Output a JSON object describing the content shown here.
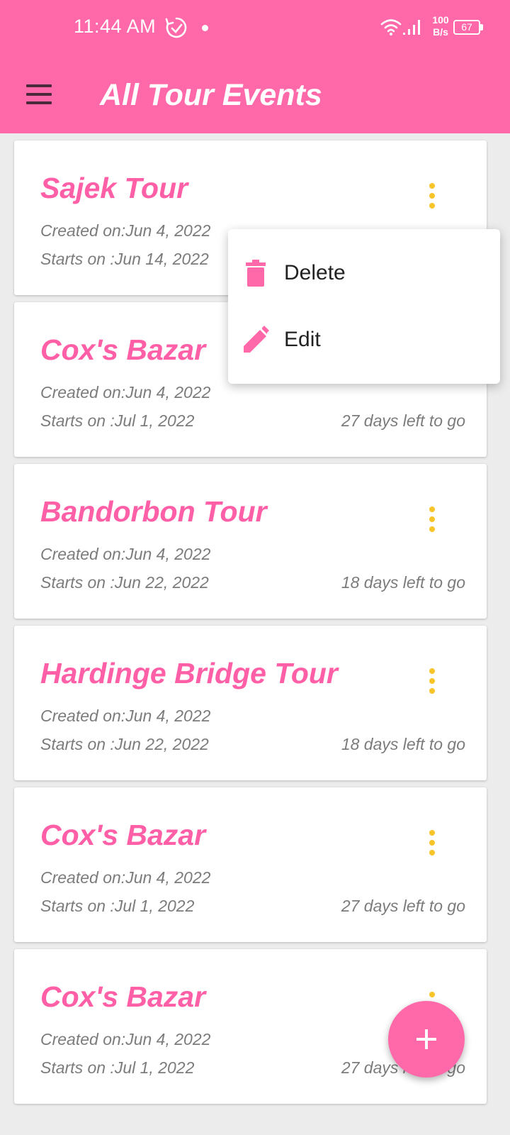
{
  "status_bar": {
    "time": "11:44 AM",
    "net_speed_value": "100",
    "net_speed_unit": "B/s",
    "battery": "67"
  },
  "app_bar": {
    "title": "All Tour Events",
    "menu_icon": "hamburger-menu-icon"
  },
  "colors": {
    "primary": "#ff69aa",
    "accent": "#f7c52a",
    "title_text": "#ff5fa6"
  },
  "events": [
    {
      "title": "Sajek Tour",
      "created_label": "Created on:",
      "created": "Jun 4, 2022",
      "starts_label": "Starts on  : ",
      "starts": "Jun 14, 2022",
      "days_left": ""
    },
    {
      "title": "Cox's Bazar",
      "created_label": "Created on:",
      "created": "Jun 4, 2022",
      "starts_label": "Starts on  : ",
      "starts": "Jul 1, 2022",
      "days_left": "27  days left to go"
    },
    {
      "title": "Bandorbon Tour",
      "created_label": "Created on:",
      "created": "Jun 4, 2022",
      "starts_label": "Starts on  : ",
      "starts": "Jun 22, 2022",
      "days_left": "18  days left to go"
    },
    {
      "title": "Hardinge Bridge Tour",
      "created_label": "Created on:",
      "created": "Jun 4, 2022",
      "starts_label": "Starts on  : ",
      "starts": "Jun 22, 2022",
      "days_left": "18  days left to go"
    },
    {
      "title": "Cox's Bazar",
      "created_label": "Created on:",
      "created": "Jun 4, 2022",
      "starts_label": "Starts on  : ",
      "starts": "Jul 1, 2022",
      "days_left": "27  days left to go"
    },
    {
      "title": "Cox's Bazar",
      "created_label": "Created on:",
      "created": "Jun 4, 2022",
      "starts_label": "Starts on  : ",
      "starts": "Jul 1, 2022",
      "days_left": "27  days left to go"
    }
  ],
  "popup_menu": {
    "items": [
      {
        "label": "Delete",
        "icon": "trash-icon"
      },
      {
        "label": "Edit",
        "icon": "pencil-icon"
      }
    ]
  },
  "fab": {
    "icon": "plus-icon"
  }
}
